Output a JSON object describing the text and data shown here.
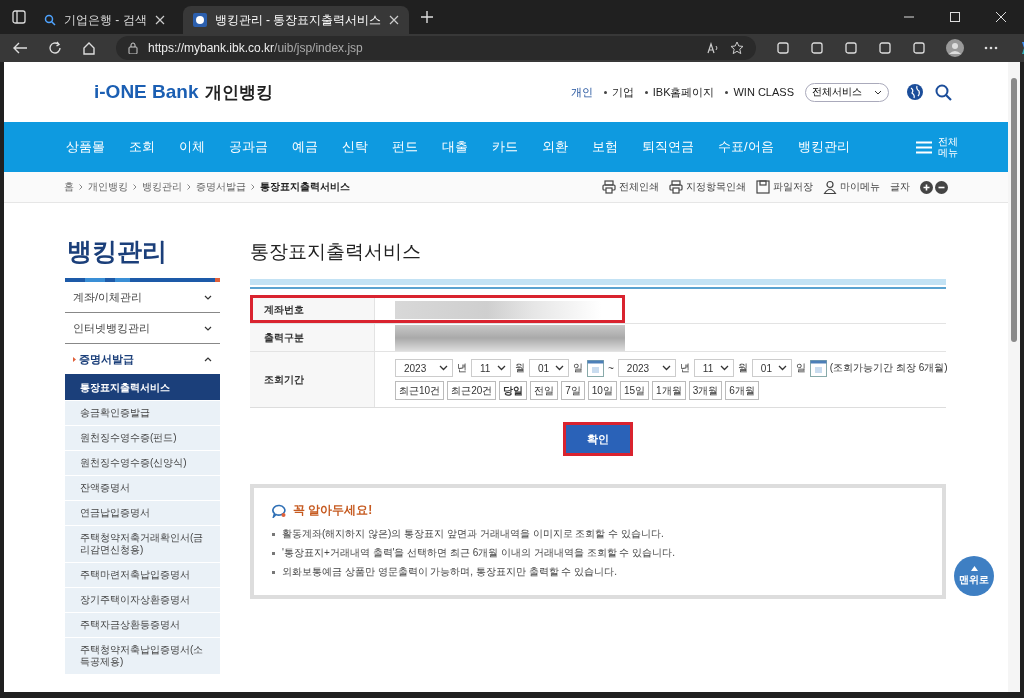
{
  "browser": {
    "tabs": [
      {
        "title": "기업은행 - 검색",
        "selected": false
      },
      {
        "title": "뱅킹관리 - 통장표지출력서비스",
        "selected": true
      }
    ],
    "url_host": "https://mybank.ibk.co.kr",
    "url_path": "/uib/jsp/index.jsp"
  },
  "header": {
    "logo": "i-ONE Bank",
    "logo_sub": "개인뱅킹",
    "links": [
      {
        "label": "개인",
        "selected": true
      },
      {
        "label": "기업",
        "selected": false
      },
      {
        "label": "IBK홈페이지",
        "selected": false
      },
      {
        "label": "WIN CLASS",
        "selected": false
      }
    ],
    "all_services": "전체서비스"
  },
  "nav": {
    "items": [
      "상품몰",
      "조회",
      "이체",
      "공과금",
      "예금",
      "신탁",
      "펀드",
      "대출",
      "카드",
      "외환",
      "보험",
      "퇴직연금",
      "수표/어음",
      "뱅킹관리"
    ],
    "all_menu": "전체\n메뉴"
  },
  "breadcrumb": [
    "홈",
    "개인뱅킹",
    "뱅킹관리",
    "증명서발급",
    "통장표지출력서비스"
  ],
  "utilities": [
    {
      "label": "전체인쇄",
      "kind": "print"
    },
    {
      "label": "지정항목인쇄",
      "kind": "print"
    },
    {
      "label": "파일저장",
      "kind": "save"
    },
    {
      "label": "마이메뉴",
      "kind": "user"
    }
  ],
  "font_size_label": "글자",
  "sidebar": {
    "title": "뱅킹관리",
    "groups": [
      {
        "label": "계좌/이체관리",
        "expanded": false
      },
      {
        "label": "인터넷뱅킹관리",
        "expanded": false
      },
      {
        "label": "증명서발급",
        "expanded": true,
        "children": [
          {
            "label": "통장표지출력서비스",
            "selected": true
          },
          {
            "label": "송금확인증발급",
            "selected": false
          },
          {
            "label": "원천징수영수증(펀드)",
            "selected": false
          },
          {
            "label": "원천징수영수증(신양식)",
            "selected": false
          },
          {
            "label": "잔액증명서",
            "selected": false
          },
          {
            "label": "연금납입증명서",
            "selected": false
          },
          {
            "label": "주택청약저축거래확인서(금리감면신청용)",
            "selected": false
          },
          {
            "label": "주택마련저축납입증명서",
            "selected": false
          },
          {
            "label": "장기주택이자상환증명서",
            "selected": false
          },
          {
            "label": "주택자금상환등증명서",
            "selected": false
          },
          {
            "label": "주택청약저축납입증명서(소득공제용)",
            "selected": false
          }
        ]
      }
    ]
  },
  "main": {
    "title": "통장표지출력서비스",
    "form": {
      "account_label": "계좌번호",
      "output_label": "출력구분",
      "period_label": "조회기간",
      "from": {
        "year": "2023",
        "year_unit": "년",
        "month": "11",
        "month_unit": "월",
        "day": "01",
        "day_unit": "일"
      },
      "tilde": "~",
      "to": {
        "year": "2023",
        "year_unit": "년",
        "month": "11",
        "month_unit": "월",
        "day": "01",
        "day_unit": "일"
      },
      "period_note": "(조회가능기간 최장 6개월)",
      "quick": [
        {
          "label": "최근10건",
          "selected": false
        },
        {
          "label": "최근20건",
          "selected": false
        },
        {
          "label": "당일",
          "selected": true
        },
        {
          "label": "전일",
          "selected": false
        },
        {
          "label": "7일",
          "selected": false
        },
        {
          "label": "10일",
          "selected": false
        },
        {
          "label": "15일",
          "selected": false
        },
        {
          "label": "1개월",
          "selected": false
        },
        {
          "label": "3개월",
          "selected": false
        },
        {
          "label": "6개월",
          "selected": false
        }
      ]
    },
    "confirm": "확인",
    "notice": {
      "title": "꼭 알아두세요!",
      "items": [
        "활동계좌(해지하지 않은)의 통장표지 앞면과 거래내역을 이미지로 조회할 수 있습니다.",
        "'통장표지+거래내역 출력'을 선택하면 최근 6개월 이내의 거래내역을 조회할 수 있습니다.",
        "외화보통예금 상품만 영문출력이 가능하며, 통장표지만 출력할 수 있습니다."
      ]
    }
  },
  "top_button": "맨위로"
}
